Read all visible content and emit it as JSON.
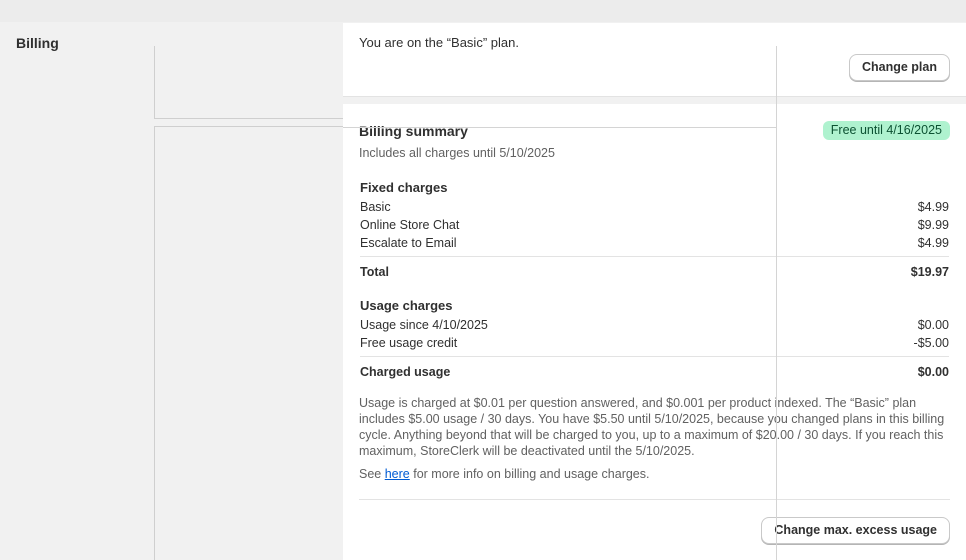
{
  "sidebar": {
    "title": "Billing"
  },
  "plan": {
    "text": "You are on the “Basic” plan.",
    "change_plan_label": "Change plan"
  },
  "summary": {
    "title": "Billing summary",
    "badge": "Free until 4/16/2025",
    "subtitle": "Includes all charges until 5/10/2025",
    "fixed": {
      "heading": "Fixed charges",
      "items": [
        {
          "label": "Basic",
          "value": "$4.99"
        },
        {
          "label": "Online Store Chat",
          "value": "$9.99"
        },
        {
          "label": "Escalate to Email",
          "value": "$4.99"
        }
      ],
      "total_label": "Total",
      "total_value": "$19.97"
    },
    "usage": {
      "heading": "Usage charges",
      "items": [
        {
          "label": "Usage since 4/10/2025",
          "value": "$0.00"
        },
        {
          "label": "Free usage credit",
          "value": "-$5.00"
        }
      ],
      "total_label": "Charged usage",
      "total_value": "$0.00"
    },
    "note": "Usage is charged at $0.01 per question answered, and $0.001 per product indexed. The “Basic” plan includes $5.00 usage / 30 days. You have $5.50 until 5/10/2025, because you changed plans in this billing cycle. Anything beyond that will be charged to you, up to a maximum of $20.00 / 30 days. If you reach this maximum, StoreClerk will be deactivated until the 5/10/2025.",
    "see_prefix": "See ",
    "see_link": "here",
    "see_suffix": " for more info on billing and usage charges.",
    "change_max_label": "Change max. excess usage"
  }
}
